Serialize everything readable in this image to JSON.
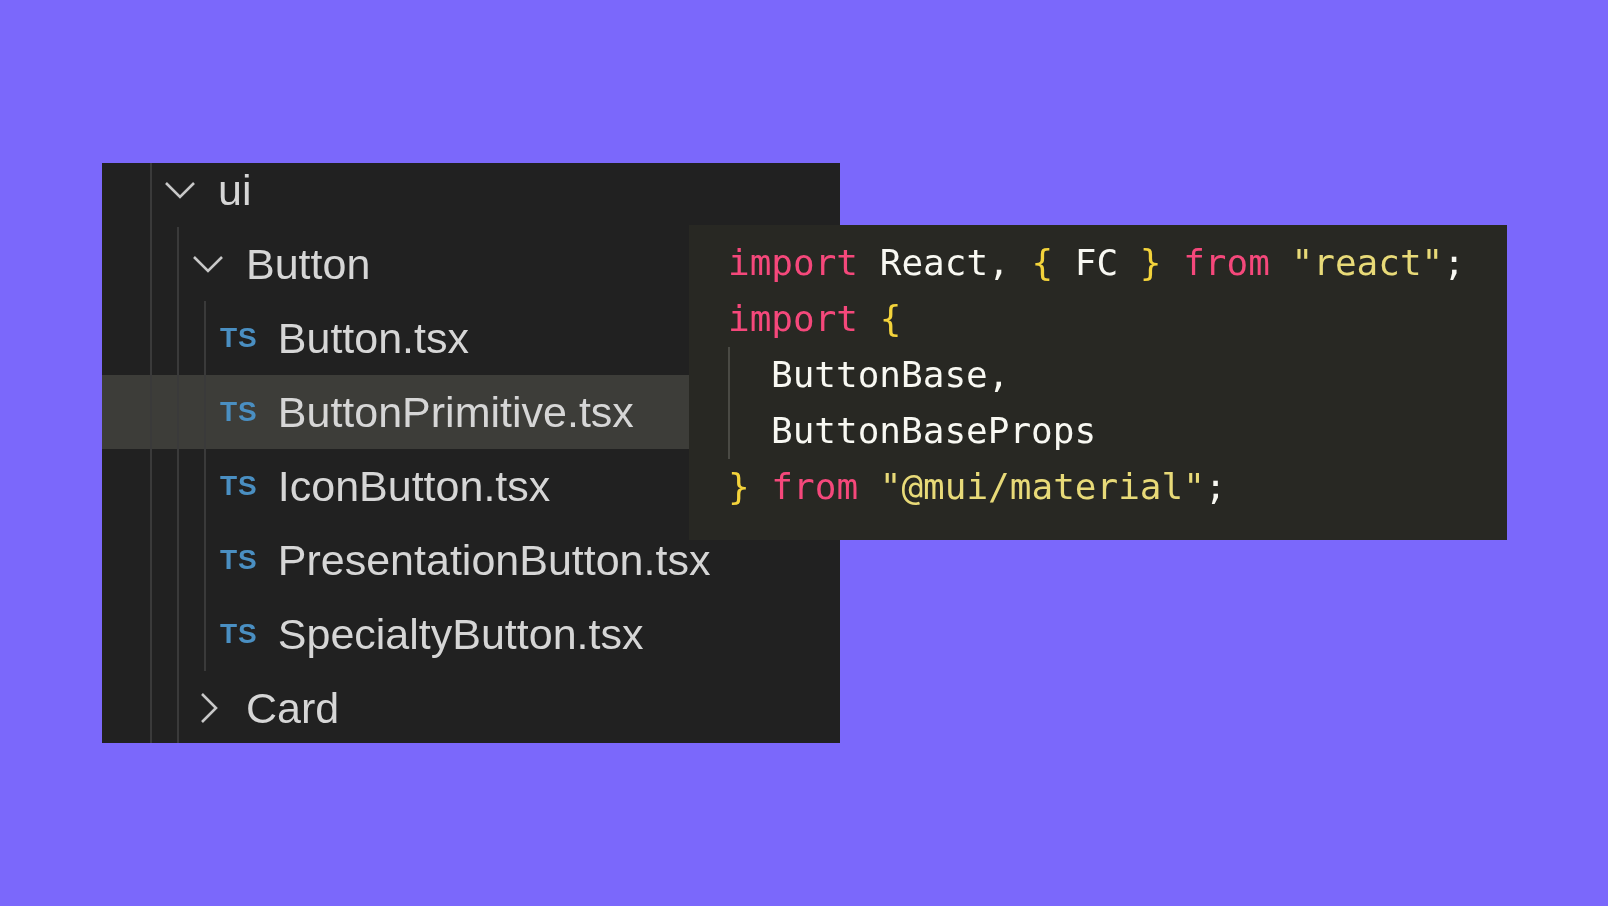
{
  "explorer": {
    "tree": [
      {
        "label": "ui",
        "kind": "folder",
        "expanded": true,
        "selected": false,
        "children": [
          {
            "label": "Button",
            "kind": "folder",
            "expanded": true,
            "selected": false,
            "children": [
              {
                "label": "Button.tsx",
                "kind": "file",
                "badge": "TS",
                "selected": false
              },
              {
                "label": "ButtonPrimitive.tsx",
                "kind": "file",
                "badge": "TS",
                "selected": true
              },
              {
                "label": "IconButton.tsx",
                "kind": "file",
                "badge": "TS",
                "selected": false
              },
              {
                "label": "PresentationButton.tsx",
                "kind": "file",
                "badge": "TS",
                "selected": false
              },
              {
                "label": "SpecialtyButton.tsx",
                "kind": "file",
                "badge": "TS",
                "selected": false
              }
            ]
          },
          {
            "label": "Card",
            "kind": "folder",
            "expanded": false,
            "selected": false
          }
        ]
      }
    ]
  },
  "code": {
    "lines": [
      {
        "indented": false,
        "tokens": [
          {
            "kind": "keyword",
            "text": "import"
          },
          {
            "kind": "plain",
            "text": " React, "
          },
          {
            "kind": "brace",
            "text": "{"
          },
          {
            "kind": "plain",
            "text": " FC "
          },
          {
            "kind": "brace",
            "text": "}"
          },
          {
            "kind": "keyword",
            "text": " from"
          },
          {
            "kind": "string",
            "text": " \"react\""
          },
          {
            "kind": "plain",
            "text": ";"
          }
        ]
      },
      {
        "indented": false,
        "tokens": [
          {
            "kind": "keyword",
            "text": "import"
          },
          {
            "kind": "brace",
            "text": " {"
          }
        ]
      },
      {
        "indented": true,
        "tokens": [
          {
            "kind": "plain",
            "text": "ButtonBase,"
          }
        ]
      },
      {
        "indented": true,
        "tokens": [
          {
            "kind": "plain",
            "text": "ButtonBaseProps"
          }
        ]
      },
      {
        "indented": false,
        "tokens": [
          {
            "kind": "brace",
            "text": "}"
          },
          {
            "kind": "keyword",
            "text": " from"
          },
          {
            "kind": "string",
            "text": " \"@mui/material\""
          },
          {
            "kind": "plain",
            "text": ";"
          }
        ]
      }
    ]
  }
}
